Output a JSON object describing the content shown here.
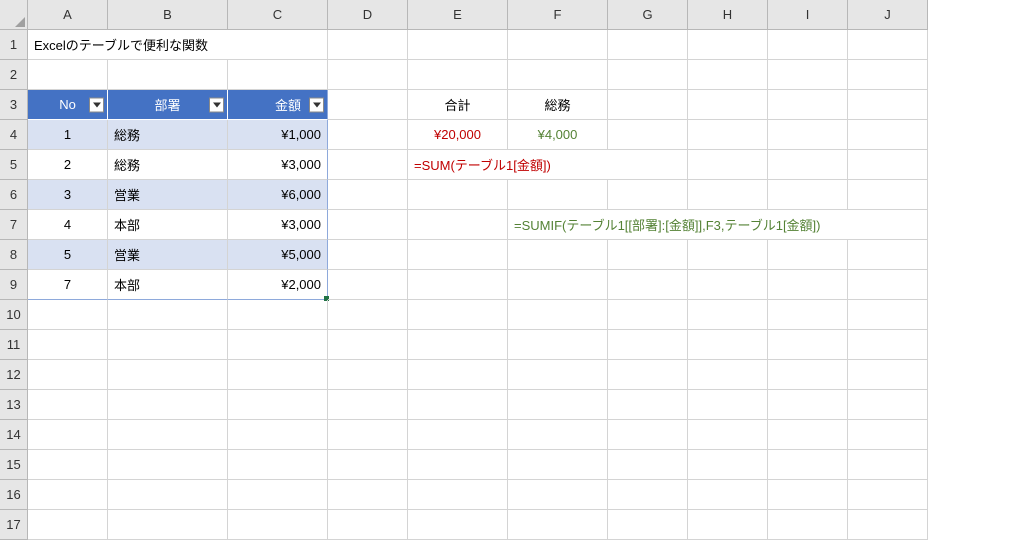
{
  "columns": [
    "A",
    "B",
    "C",
    "D",
    "E",
    "F",
    "G",
    "H",
    "I",
    "J"
  ],
  "rows": [
    "1",
    "2",
    "3",
    "4",
    "5",
    "6",
    "7",
    "8",
    "9",
    "10",
    "11",
    "12",
    "13",
    "14",
    "15",
    "16",
    "17"
  ],
  "title": "Excelのテーブルで便利な関数",
  "table": {
    "headers": {
      "no": "No",
      "dept": "部署",
      "amount": "金額"
    },
    "rows": [
      {
        "no": "1",
        "dept": "総務",
        "amount": "¥1,000"
      },
      {
        "no": "2",
        "dept": "総務",
        "amount": "¥3,000"
      },
      {
        "no": "3",
        "dept": "営業",
        "amount": "¥6,000"
      },
      {
        "no": "4",
        "dept": "本部",
        "amount": "¥3,000"
      },
      {
        "no": "5",
        "dept": "営業",
        "amount": "¥5,000"
      },
      {
        "no": "7",
        "dept": "本部",
        "amount": "¥2,000"
      }
    ]
  },
  "labels": {
    "total": "合計",
    "soumu": "総務"
  },
  "values": {
    "total": "¥20,000",
    "soumu": "¥4,000"
  },
  "formulas": {
    "sum": "=SUM(テーブル1[金額])",
    "sumif": "=SUMIF(テーブル1[[部署]:[金額]],F3,テーブル1[金額])"
  },
  "chart_data": {
    "type": "table",
    "title": "Excelのテーブルで便利な関数",
    "columns": [
      "No",
      "部署",
      "金額"
    ],
    "rows": [
      [
        1,
        "総務",
        1000
      ],
      [
        2,
        "総務",
        3000
      ],
      [
        3,
        "営業",
        6000
      ],
      [
        4,
        "本部",
        3000
      ],
      [
        5,
        "営業",
        5000
      ],
      [
        7,
        "本部",
        2000
      ]
    ],
    "aggregates": {
      "合計": 20000,
      "総務": 4000
    }
  }
}
